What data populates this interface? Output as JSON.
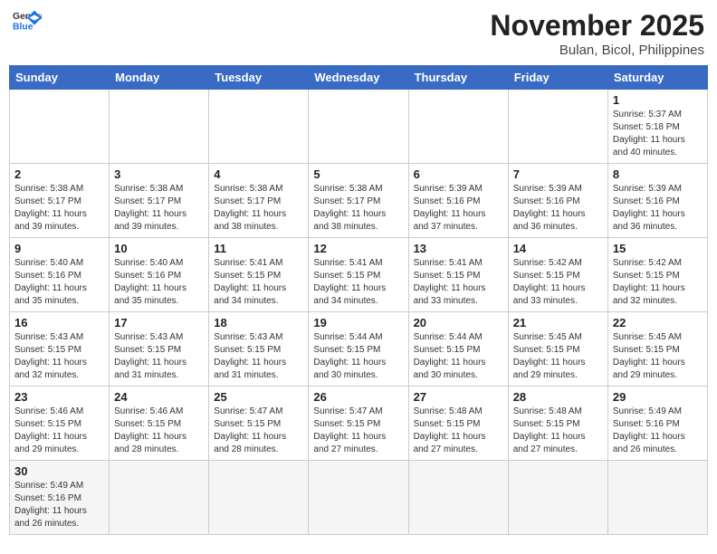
{
  "header": {
    "logo_line1": "General",
    "logo_line2": "Blue",
    "month": "November 2025",
    "location": "Bulan, Bicol, Philippines"
  },
  "weekdays": [
    "Sunday",
    "Monday",
    "Tuesday",
    "Wednesday",
    "Thursday",
    "Friday",
    "Saturday"
  ],
  "weeks": [
    [
      {
        "day": "",
        "info": ""
      },
      {
        "day": "",
        "info": ""
      },
      {
        "day": "",
        "info": ""
      },
      {
        "day": "",
        "info": ""
      },
      {
        "day": "",
        "info": ""
      },
      {
        "day": "",
        "info": ""
      },
      {
        "day": "1",
        "info": "Sunrise: 5:37 AM\nSunset: 5:18 PM\nDaylight: 11 hours\nand 40 minutes."
      }
    ],
    [
      {
        "day": "2",
        "info": "Sunrise: 5:38 AM\nSunset: 5:17 PM\nDaylight: 11 hours\nand 39 minutes."
      },
      {
        "day": "3",
        "info": "Sunrise: 5:38 AM\nSunset: 5:17 PM\nDaylight: 11 hours\nand 39 minutes."
      },
      {
        "day": "4",
        "info": "Sunrise: 5:38 AM\nSunset: 5:17 PM\nDaylight: 11 hours\nand 38 minutes."
      },
      {
        "day": "5",
        "info": "Sunrise: 5:38 AM\nSunset: 5:17 PM\nDaylight: 11 hours\nand 38 minutes."
      },
      {
        "day": "6",
        "info": "Sunrise: 5:39 AM\nSunset: 5:16 PM\nDaylight: 11 hours\nand 37 minutes."
      },
      {
        "day": "7",
        "info": "Sunrise: 5:39 AM\nSunset: 5:16 PM\nDaylight: 11 hours\nand 36 minutes."
      },
      {
        "day": "8",
        "info": "Sunrise: 5:39 AM\nSunset: 5:16 PM\nDaylight: 11 hours\nand 36 minutes."
      }
    ],
    [
      {
        "day": "9",
        "info": "Sunrise: 5:40 AM\nSunset: 5:16 PM\nDaylight: 11 hours\nand 35 minutes."
      },
      {
        "day": "10",
        "info": "Sunrise: 5:40 AM\nSunset: 5:16 PM\nDaylight: 11 hours\nand 35 minutes."
      },
      {
        "day": "11",
        "info": "Sunrise: 5:41 AM\nSunset: 5:15 PM\nDaylight: 11 hours\nand 34 minutes."
      },
      {
        "day": "12",
        "info": "Sunrise: 5:41 AM\nSunset: 5:15 PM\nDaylight: 11 hours\nand 34 minutes."
      },
      {
        "day": "13",
        "info": "Sunrise: 5:41 AM\nSunset: 5:15 PM\nDaylight: 11 hours\nand 33 minutes."
      },
      {
        "day": "14",
        "info": "Sunrise: 5:42 AM\nSunset: 5:15 PM\nDaylight: 11 hours\nand 33 minutes."
      },
      {
        "day": "15",
        "info": "Sunrise: 5:42 AM\nSunset: 5:15 PM\nDaylight: 11 hours\nand 32 minutes."
      }
    ],
    [
      {
        "day": "16",
        "info": "Sunrise: 5:43 AM\nSunset: 5:15 PM\nDaylight: 11 hours\nand 32 minutes."
      },
      {
        "day": "17",
        "info": "Sunrise: 5:43 AM\nSunset: 5:15 PM\nDaylight: 11 hours\nand 31 minutes."
      },
      {
        "day": "18",
        "info": "Sunrise: 5:43 AM\nSunset: 5:15 PM\nDaylight: 11 hours\nand 31 minutes."
      },
      {
        "day": "19",
        "info": "Sunrise: 5:44 AM\nSunset: 5:15 PM\nDaylight: 11 hours\nand 30 minutes."
      },
      {
        "day": "20",
        "info": "Sunrise: 5:44 AM\nSunset: 5:15 PM\nDaylight: 11 hours\nand 30 minutes."
      },
      {
        "day": "21",
        "info": "Sunrise: 5:45 AM\nSunset: 5:15 PM\nDaylight: 11 hours\nand 29 minutes."
      },
      {
        "day": "22",
        "info": "Sunrise: 5:45 AM\nSunset: 5:15 PM\nDaylight: 11 hours\nand 29 minutes."
      }
    ],
    [
      {
        "day": "23",
        "info": "Sunrise: 5:46 AM\nSunset: 5:15 PM\nDaylight: 11 hours\nand 29 minutes."
      },
      {
        "day": "24",
        "info": "Sunrise: 5:46 AM\nSunset: 5:15 PM\nDaylight: 11 hours\nand 28 minutes."
      },
      {
        "day": "25",
        "info": "Sunrise: 5:47 AM\nSunset: 5:15 PM\nDaylight: 11 hours\nand 28 minutes."
      },
      {
        "day": "26",
        "info": "Sunrise: 5:47 AM\nSunset: 5:15 PM\nDaylight: 11 hours\nand 27 minutes."
      },
      {
        "day": "27",
        "info": "Sunrise: 5:48 AM\nSunset: 5:15 PM\nDaylight: 11 hours\nand 27 minutes."
      },
      {
        "day": "28",
        "info": "Sunrise: 5:48 AM\nSunset: 5:15 PM\nDaylight: 11 hours\nand 27 minutes."
      },
      {
        "day": "29",
        "info": "Sunrise: 5:49 AM\nSunset: 5:16 PM\nDaylight: 11 hours\nand 26 minutes."
      }
    ],
    [
      {
        "day": "30",
        "info": "Sunrise: 5:49 AM\nSunset: 5:16 PM\nDaylight: 11 hours\nand 26 minutes."
      },
      {
        "day": "",
        "info": ""
      },
      {
        "day": "",
        "info": ""
      },
      {
        "day": "",
        "info": ""
      },
      {
        "day": "",
        "info": ""
      },
      {
        "day": "",
        "info": ""
      },
      {
        "day": "",
        "info": ""
      }
    ]
  ]
}
